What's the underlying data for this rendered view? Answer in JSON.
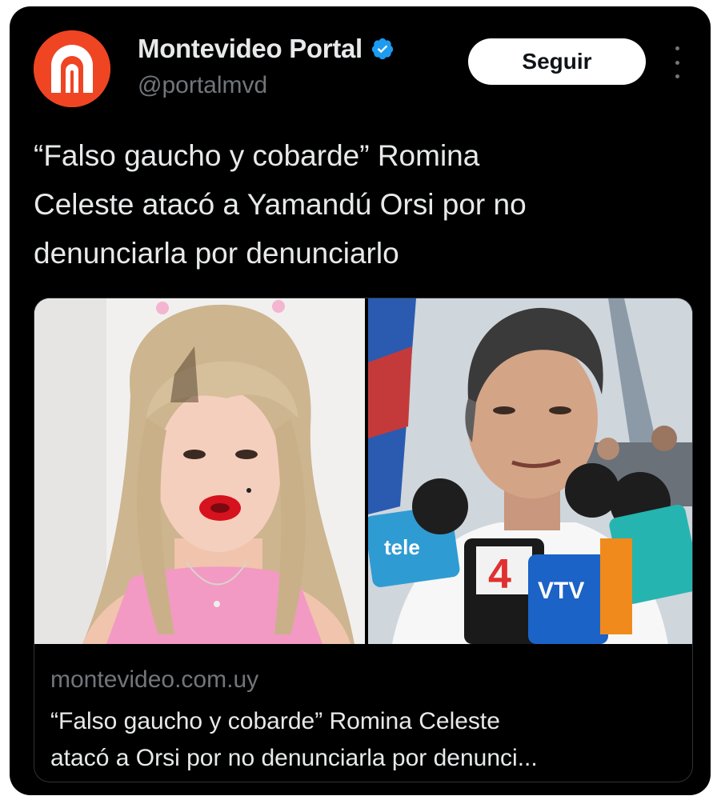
{
  "account": {
    "name": "Montevideo Portal",
    "handle": "@portalmvd",
    "verified": true,
    "avatar_icon": "montevideo-portal-logo-icon",
    "avatar_color": "#ef4523"
  },
  "actions": {
    "follow_label": "Seguir",
    "more_icon": "more-vertical-icon"
  },
  "tweet": {
    "lines": [
      "“Falso gaucho y cobarde” Romina",
      "Celeste atacó a Yamandú Orsi por no",
      "denunciarla por denunciarlo"
    ]
  },
  "link_card": {
    "domain": "montevideo.com.uy",
    "title_lines": [
      "“Falso gaucho y cobarde” Romina Celeste",
      "atacó a Orsi por no denunciarla por denunci..."
    ],
    "mic_labels": {
      "mic1": "tele",
      "mic2": "4",
      "mic3": "VTV"
    }
  },
  "colors": {
    "background": "#000000",
    "text": "#e7e9ea",
    "muted": "#71767b",
    "verified_badge": "#1d9bf0",
    "border": "#2f3336"
  }
}
